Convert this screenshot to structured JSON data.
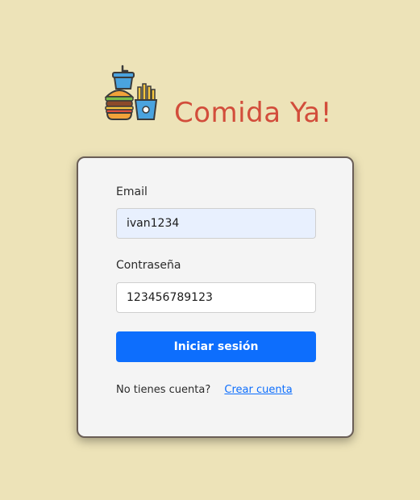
{
  "brand": {
    "title": "Comida Ya!",
    "logo_icon": "fast-food-icon"
  },
  "form": {
    "email_label": "Email",
    "email_value": "ivan1234",
    "password_label": "Contraseña",
    "password_value": "123456789123",
    "submit_label": "Iniciar sesión",
    "no_account_text": "No tienes cuenta?",
    "create_account_link": "Crear cuenta"
  },
  "colors": {
    "background": "#ede3b8",
    "brand": "#d24d3b",
    "primary": "#0d6efd",
    "card": "#f4f4f4"
  }
}
